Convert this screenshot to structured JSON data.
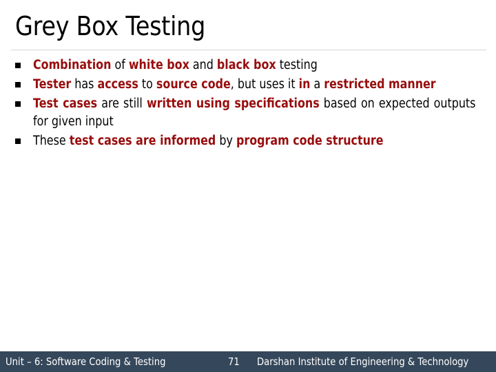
{
  "slide": {
    "title": "Grey Box Testing",
    "bullets": [
      {
        "segments": [
          {
            "text": "Combination",
            "highlight": true
          },
          {
            "text": " of ",
            "highlight": false
          },
          {
            "text": "white box",
            "highlight": true
          },
          {
            "text": " and ",
            "highlight": false
          },
          {
            "text": "black box",
            "highlight": true
          },
          {
            "text": " testing",
            "highlight": false
          }
        ]
      },
      {
        "segments": [
          {
            "text": "Tester",
            "highlight": true
          },
          {
            "text": " has ",
            "highlight": false
          },
          {
            "text": "access",
            "highlight": true
          },
          {
            "text": " to ",
            "highlight": false
          },
          {
            "text": "source code",
            "highlight": true
          },
          {
            "text": ", but uses it ",
            "highlight": false
          },
          {
            "text": "in",
            "highlight": true
          },
          {
            "text": " a ",
            "highlight": false
          },
          {
            "text": "restricted manner",
            "highlight": true
          }
        ]
      },
      {
        "segments": [
          {
            "text": "Test cases",
            "highlight": true
          },
          {
            "text": " are still ",
            "highlight": false
          },
          {
            "text": "written using specifications",
            "highlight": true
          },
          {
            "text": " based on expected outputs for given input",
            "highlight": false
          }
        ]
      },
      {
        "segments": [
          {
            "text": "These ",
            "highlight": false
          },
          {
            "text": "test cases are informed",
            "highlight": true
          },
          {
            "text": " by ",
            "highlight": false
          },
          {
            "text": "program code structure",
            "highlight": true
          }
        ]
      }
    ]
  },
  "footer": {
    "unit": "Unit – 6: Software Coding & Testing",
    "page_number": "71",
    "institute": "Darshan Institute of Engineering & Technology"
  },
  "colors": {
    "highlight": "#980d0d",
    "footer_bg": "#35475a"
  }
}
